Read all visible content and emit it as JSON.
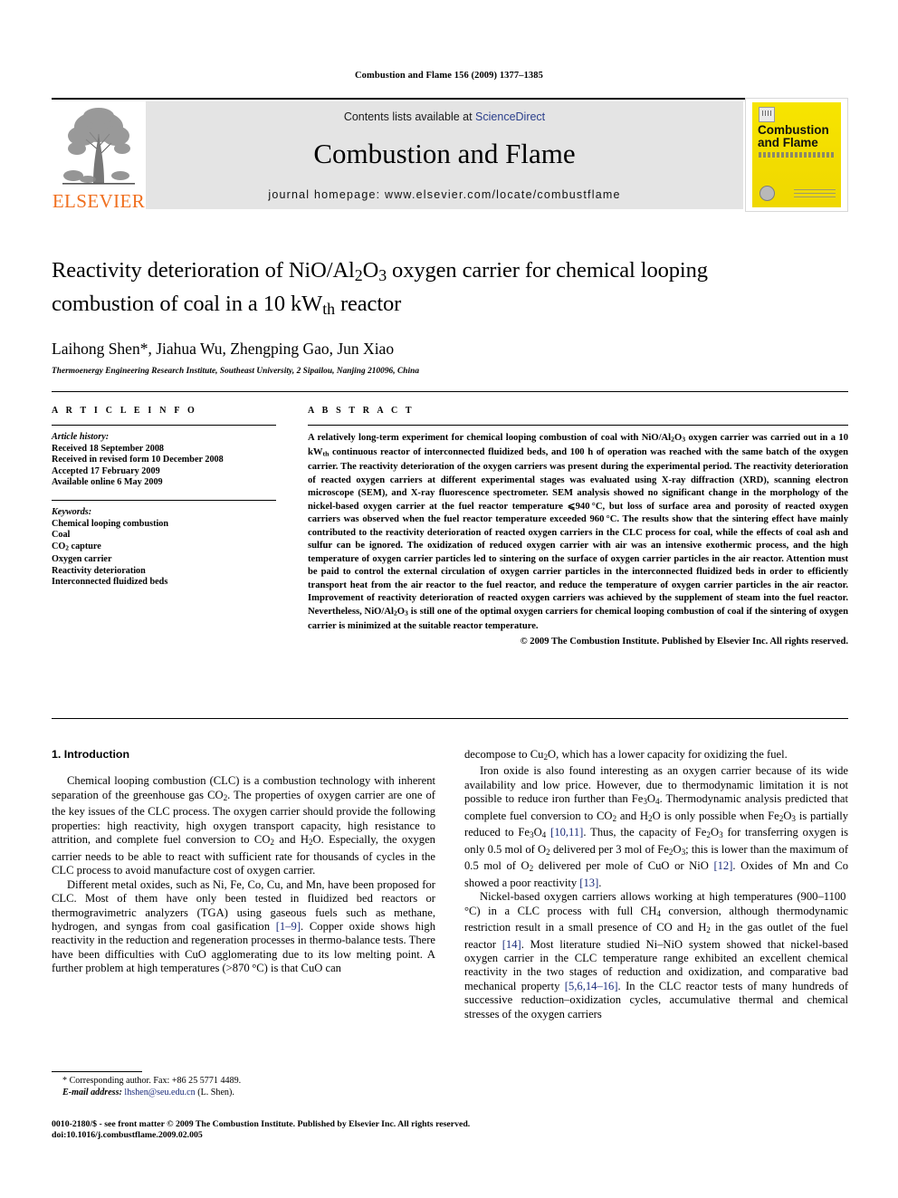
{
  "running_head": "Combustion and Flame 156 (2009) 1377–1385",
  "masthead": {
    "contents_text": "Contents lists available at ",
    "sciencedirect": "ScienceDirect",
    "journal_title": "Combustion and Flame",
    "homepage": "journal homepage: www.elsevier.com/locate/combustflame",
    "publisher_logo_text": "ELSEVIER",
    "cover_title_line1": "Combustion",
    "cover_title_line2": "and Flame"
  },
  "article": {
    "title_line1": "Reactivity deterioration of NiO/Al2O3 oxygen carrier for chemical looping",
    "title_line2": "combustion of coal in a 10 kWth reactor",
    "authors": "Laihong Shen*, Jiahua Wu, Zhengping Gao, Jun Xiao",
    "affiliation": "Thermoenergy Engineering Research Institute, Southeast University, 2 Sipailou, Nanjing 210096, China"
  },
  "article_info": {
    "heading": "A R T I C L E    I N F O",
    "history_label": "Article history:",
    "history": [
      "Received 18 September 2008",
      "Received in revised form 10 December 2008",
      "Accepted 17 February 2009",
      "Available online 6 May 2009"
    ],
    "keywords_label": "Keywords:",
    "keywords": [
      "Chemical looping combustion",
      "Coal",
      "CO2 capture",
      "Oxygen carrier",
      "Reactivity deterioration",
      "Interconnected fluidized beds"
    ]
  },
  "abstract": {
    "heading": "A B S T R A C T",
    "text": "A relatively long-term experiment for chemical looping combustion of coal with NiO/Al2O3 oxygen carrier was carried out in a 10 kWth continuous reactor of interconnected fluidized beds, and 100 h of operation was reached with the same batch of the oxygen carrier. The reactivity deterioration of the oxygen carriers was present during the experimental period. The reactivity deterioration of reacted oxygen carriers at different experimental stages was evaluated using X-ray diffraction (XRD), scanning electron microscope (SEM), and X-ray fluorescence spectrometer. SEM analysis showed no significant change in the morphology of the nickel-based oxygen carrier at the fuel reactor temperature ⩽940 °C, but loss of surface area and porosity of reacted oxygen carriers was observed when the fuel reactor temperature exceeded 960 °C. The results show that the sintering effect have mainly contributed to the reactivity deterioration of reacted oxygen carriers in the CLC process for coal, while the effects of coal ash and sulfur can be ignored. The oxidization of reduced oxygen carrier with air was an intensive exothermic process, and the high temperature of oxygen carrier particles led to sintering on the surface of oxygen carrier particles in the air reactor. Attention must be paid to control the external circulation of oxygen carrier particles in the interconnected fluidized beds in order to efficiently transport heat from the air reactor to the fuel reactor, and reduce the temperature of oxygen carrier particles in the air reactor. Improvement of reactivity deterioration of reacted oxygen carriers was achieved by the supplement of steam into the fuel reactor. Nevertheless, NiO/Al2O3 is still one of the optimal oxygen carriers for chemical looping combustion of coal if the sintering of oxygen carrier is minimized at the suitable reactor temperature.",
    "copyright": "© 2009 The Combustion Institute. Published by Elsevier Inc. All rights reserved."
  },
  "body": {
    "section_heading": "1. Introduction",
    "left_paragraph_1": "Chemical looping combustion (CLC) is a combustion technology with inherent separation of the greenhouse gas CO2. The properties of oxygen carrier are one of the key issues of the CLC process. The oxygen carrier should provide the following properties: high reactivity, high oxygen transport capacity, high resistance to attrition, and complete fuel conversion to CO2 and H2O. Especially, the oxygen carrier needs to be able to react with sufficient rate for thousands of cycles in the CLC process to avoid manufacture cost of oxygen carrier.",
    "left_paragraph_2": "Different metal oxides, such as Ni, Fe, Co, Cu, and Mn, have been proposed for CLC. Most of them have only been tested in fluidized bed reactors or thermogravimetric analyzers (TGA) using gaseous fuels such as methane, hydrogen, and syngas from coal gasification [1–9]. Copper oxide shows high reactivity in the reduction and regeneration processes in thermo-balance tests. There have been difficulties with CuO agglomerating due to its low melting point. A further problem at high temperatures (>870 °C) is that CuO can",
    "right_paragraph_1": "decompose to Cu2O, which has a lower capacity for oxidizing the fuel.",
    "right_paragraph_2": "Iron oxide is also found interesting as an oxygen carrier because of its wide availability and low price. However, due to thermodynamic limitation it is not possible to reduce iron further than Fe3O4. Thermodynamic analysis predicted that complete fuel conversion to CO2 and H2O is only possible when Fe2O3 is partially reduced to Fe3O4 [10,11]. Thus, the capacity of Fe2O3 for transferring oxygen is only 0.5 mol of O2 delivered per 3 mol of Fe2O3; this is lower than the maximum of 0.5 mol of O2 delivered per mole of CuO or NiO [12]. Oxides of Mn and Co showed a poor reactivity [13].",
    "right_paragraph_3": "Nickel-based oxygen carriers allows working at high temperatures (900–1100 °C) in a CLC process with full CH4 conversion, although thermodynamic restriction result in a small presence of CO and H2 in the gas outlet of the fuel reactor [14]. Most literature studied Ni–NiO system showed that nickel-based oxygen carrier in the CLC temperature range exhibited an excellent chemical reactivity in the two stages of reduction and oxidization, and comparative bad mechanical property [5,6,14–16]. In the CLC reactor tests of many hundreds of successive reduction–oxidization cycles, accumulative thermal and chemical stresses of the oxygen carriers"
  },
  "footnote": {
    "corresponding": "* Corresponding author. Fax: +86 25 5771 4489.",
    "email_label": "E-mail address:",
    "email": "lhshen@seu.edu.cn",
    "email_suffix": "(L. Shen)."
  },
  "bottom": {
    "line1": "0010-2180/$ - see front matter © 2009 The Combustion Institute. Published by Elsevier Inc. All rights reserved.",
    "line2": "doi:10.1016/j.combustflame.2009.02.005"
  },
  "colors": {
    "link": "#1a2b7a",
    "elsevier_orange": "#f06f1e",
    "cover_yellow": "#f2dc00",
    "banner_grey": "#e4e4e4"
  }
}
